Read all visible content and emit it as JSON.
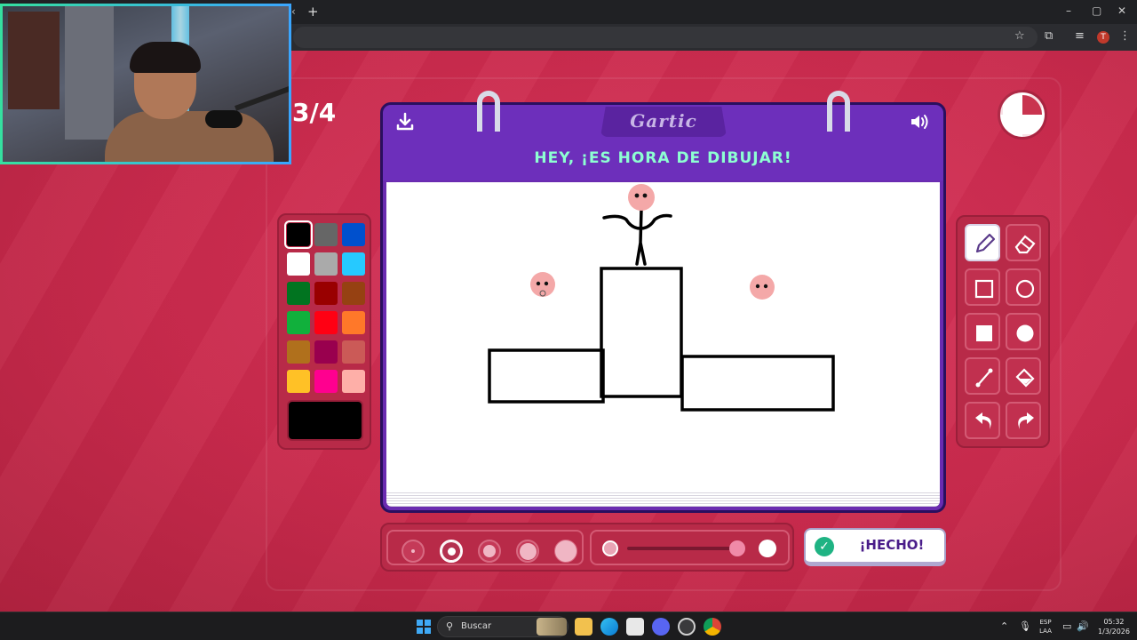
{
  "browser": {
    "new_tab_symbol": "+",
    "tab_scroll_symbol": "‹",
    "icons": [
      "bookmark-star-icon",
      "extensions-icon",
      "media-icon",
      "menu-kebab-icon"
    ],
    "profile_initial": "T",
    "window_controls": [
      "–",
      "▢",
      "✕"
    ]
  },
  "game": {
    "round": "3/4",
    "title_logo": "Gartic",
    "prompt": "HEY, ¡ES HORA DE DIBUJAR!",
    "done_label": "¡HECHO!",
    "timer_remaining_fraction": 0.75,
    "palette": {
      "colors": [
        "#000000",
        "#666666",
        "#0050cd",
        "#ffffff",
        "#aaaaaa",
        "#26c9ff",
        "#017420",
        "#990000",
        "#964112",
        "#11b03c",
        "#ff0013",
        "#ff7829",
        "#b0701c",
        "#99004e",
        "#cb5a57",
        "#ffc126",
        "#ff008f",
        "#feafa8"
      ],
      "selected_index": 0,
      "current_color": "#000000"
    },
    "tools": [
      "pen-icon",
      "eraser-icon",
      "rectangle-outline-icon",
      "circle-outline-icon",
      "rectangle-filled-icon",
      "circle-filled-icon",
      "line-icon",
      "fill-bucket-icon",
      "undo-icon",
      "redo-icon"
    ],
    "active_tool": "pen-icon",
    "brush_sizes": 5,
    "active_brush_index": 1,
    "opacity_fraction": 0.95
  },
  "taskbar": {
    "search_placeholder": "Buscar",
    "language_top": "ESP",
    "language_bottom": "LAA",
    "time": "05:32",
    "date": "1/3/2026"
  }
}
